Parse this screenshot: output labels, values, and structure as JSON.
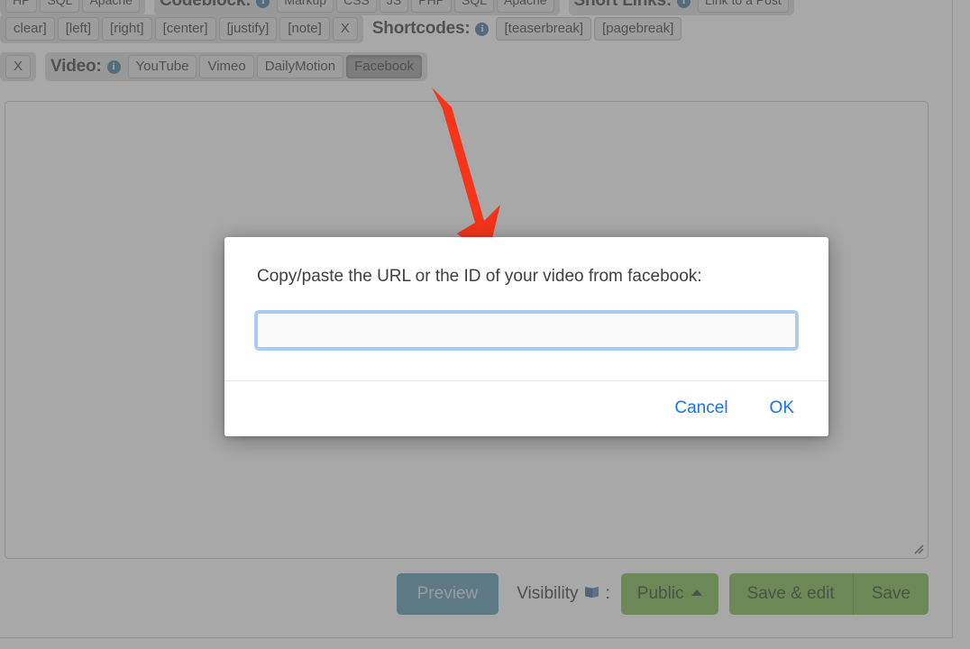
{
  "toolbar": {
    "row1": {
      "left_partial_buttons": [
        "HP",
        "SQL",
        "Apache"
      ],
      "codeblock": {
        "label": "Codeblock:",
        "info_icon": "info-icon",
        "buttons": [
          "Markup",
          "CSS",
          "JS",
          "PHP",
          "SQL",
          "Apache"
        ]
      },
      "short_links": {
        "label": "Short Links:",
        "info_icon": "info-icon",
        "buttons": [
          "Link to a Post"
        ]
      }
    },
    "row2": {
      "align_buttons": [
        "clear]",
        "[left]",
        "[right]",
        "[center]",
        "[justify]",
        "[note]",
        "X"
      ],
      "shortcodes": {
        "label": "Shortcodes:",
        "info_icon": "info-icon",
        "buttons": [
          "[teaserbreak]",
          "[pagebreak]"
        ]
      }
    },
    "row3": {
      "clear_button": "X",
      "video": {
        "label": "Video:",
        "info_icon": "info-icon",
        "buttons": [
          "YouTube",
          "Vimeo",
          "DailyMotion",
          "Facebook"
        ],
        "active_button": "Facebook"
      }
    }
  },
  "editor": {
    "content": "",
    "resize_grip": "resize-grip-icon"
  },
  "footer": {
    "preview_label": "Preview",
    "visibility_label": "Visibility",
    "visibility_icon": "book-icon",
    "colon": ":",
    "visibility_value": "Public",
    "caret_icon": "caret-up-icon",
    "save_edit_label": "Save & edit",
    "save_label": "Save"
  },
  "annotation": {
    "arrow_icon": "red-arrow-icon",
    "arrow_color": "#f5341a"
  },
  "dialog": {
    "message": "Copy/paste the URL or the ID of your video from facebook:",
    "input_value": "",
    "input_placeholder": "",
    "cancel_label": "Cancel",
    "ok_label": "OK",
    "accent_color": "#1a73e8"
  }
}
